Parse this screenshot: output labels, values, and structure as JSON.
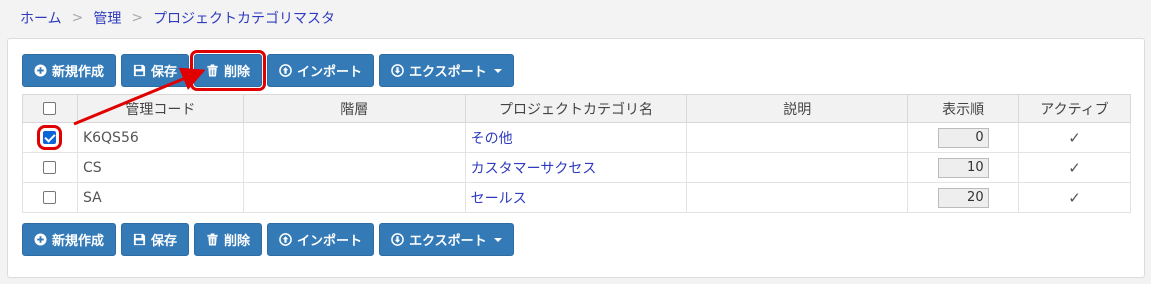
{
  "breadcrumb": {
    "home": "ホーム",
    "admin": "管理",
    "current": "プロジェクトカテゴリマスタ",
    "separator": ">"
  },
  "toolbar": {
    "new_label": "新規作成",
    "save_label": "保存",
    "delete_label": "削除",
    "import_label": "インポート",
    "export_label": "エクスポート"
  },
  "table": {
    "headers": [
      "",
      "管理コード",
      "階層",
      "プロジェクトカテゴリ名",
      "説明",
      "表示順",
      "アクティブ"
    ],
    "rows": [
      {
        "checked": true,
        "code": "K6QS56",
        "hierarchy": "",
        "name": "その他",
        "description": "",
        "order": "0",
        "active": "✓"
      },
      {
        "checked": false,
        "code": "CS",
        "hierarchy": "",
        "name": "カスタマーサクセス",
        "description": "",
        "order": "10",
        "active": "✓"
      },
      {
        "checked": false,
        "code": "SA",
        "hierarchy": "",
        "name": "セールス",
        "description": "",
        "order": "20",
        "active": "✓"
      }
    ]
  },
  "colors": {
    "button": "#337ab7",
    "link": "#2f3bbf",
    "highlight": "#e00000",
    "checkbox": "#0a66d8"
  }
}
